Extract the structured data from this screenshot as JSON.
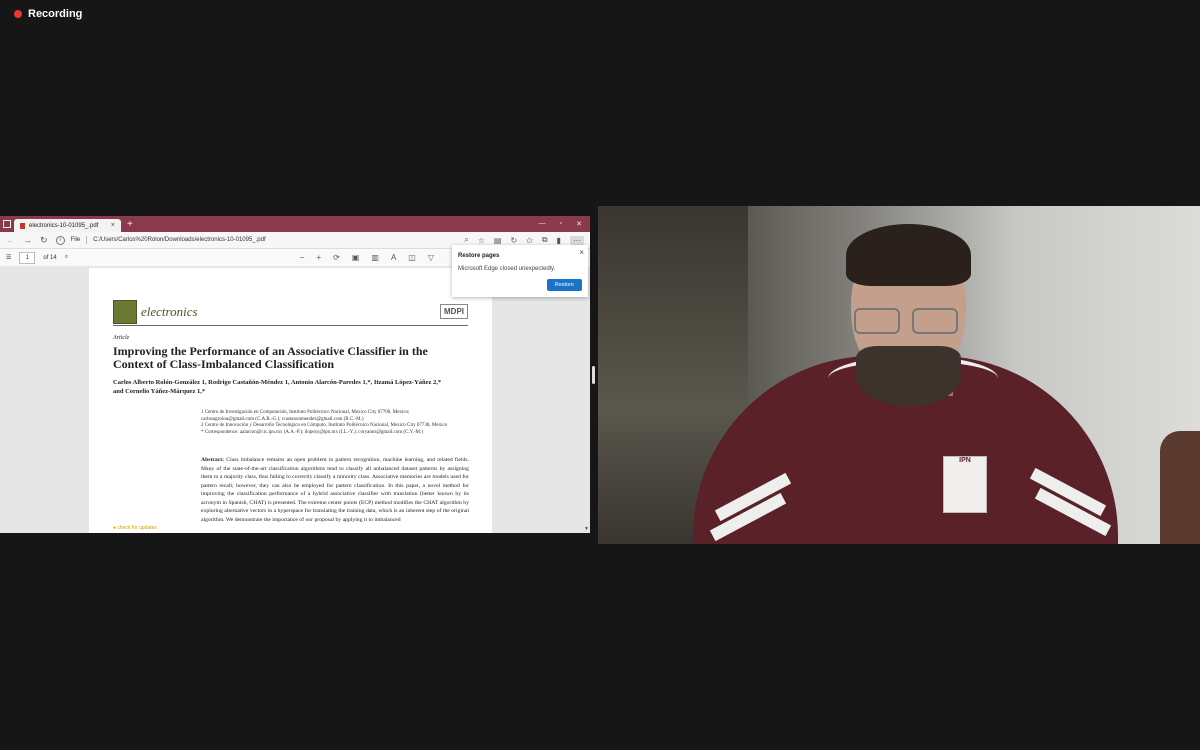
{
  "recording": {
    "label": "Recording"
  },
  "browser": {
    "tab_title": "electronics-10-01095_.pdf",
    "tab_close": "×",
    "new_tab": "+",
    "win_controls": [
      "—",
      "▫",
      "✕"
    ],
    "file_label": "File",
    "url": "C:/Users/Carlos%20Rolon/Downloads/electronics-10-01095_.pdf"
  },
  "pdf_toolbar": {
    "page_number": "1",
    "page_total": "of 14"
  },
  "pdf_page": {
    "journal": "electronics",
    "publisher": "MDPI",
    "type": "Article",
    "title": "Improving the Performance of an Associative Classifier in the Context of Class-Imbalanced Classification",
    "authors": "Carlos Alberto Rolón-González 1, Rodrigo Castañón-Méndez 1, Antonio Alarcón-Paredes 1,*, Itzamá López-Yáñez 2,* and Cornelio Yáñez-Márquez 1,*",
    "affiliation_1": "1   Centro de Investigación en Computación, Instituto Politécnico Nacional, Mexico City 07700, Mexico; carlosagrolon@gmail.com (C.A.R.-G.); rcastanonmendez@gmail.com (R.C.-M.)",
    "affiliation_2": "2   Centro de Innovación y Desarrollo Tecnológico en Cómputo, Instituto Politécnico Nacional, Mexico City 07738, Mexico",
    "correspondence": "*   Correspondence: aalarcon@cic.ipn.mx (A.A.-P.); ilopezy@ipn.mx (I.L.-Y.); coryanez@gmail.com (C.Y.-M.)",
    "abstract_label": "Abstract:",
    "abstract_text": "Class imbalance remains an open problem in pattern recognition, machine learning, and related fields. Many of the state-of-the-art classification algorithms tend to classify all unbalanced dataset patterns by assigning them to a majority class, thus failing to correctly classify a minority class. Associative memories are models used for pattern recall; however, they can also be employed for pattern classification. In this paper, a novel method for improving the classification performance of a hybrid associative classifier with translation (better known by its acronym in Spanish, CHAT) is presented. The extreme center points (ECP) method modifies the CHAT algorithm by exploring alternative vectors in a hyperspace for translating the training data, which is an inherent step of the original algorithm. We demonstrate the importance of our proposal by applying it to imbalanced",
    "check_updates": "check for updates"
  },
  "popup": {
    "title": "Restore pages",
    "message": "Microsoft Edge closed unexpectedly.",
    "button": "Restore",
    "close": "×"
  },
  "webcam": {
    "badge_text": "IPN"
  },
  "colors": {
    "background": "#161616",
    "recording_dot": "#e53935",
    "titlebar": "#8a3a4a",
    "restore_button": "#1a73c8",
    "jacket": "#5a2129"
  }
}
